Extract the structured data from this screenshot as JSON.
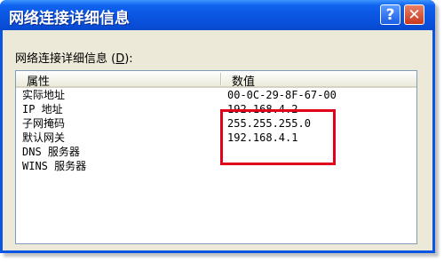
{
  "window": {
    "title": "网络连接详细信息",
    "help_label": "?",
    "close_label": "✕"
  },
  "caption": {
    "text": "网络连接详细信息 (",
    "accesskey": "D",
    "suffix": "):"
  },
  "table": {
    "columns": [
      "属性",
      "数值"
    ],
    "rows": [
      {
        "property": "实际地址",
        "value": "00-0C-29-8F-67-00"
      },
      {
        "property": "IP 地址",
        "value": "192.168.4.2"
      },
      {
        "property": "子网掩码",
        "value": "255.255.255.0"
      },
      {
        "property": "默认网关",
        "value": "192.168.4.1"
      },
      {
        "property": "DNS 服务器",
        "value": ""
      },
      {
        "property": "WINS 服务器",
        "value": ""
      }
    ]
  },
  "colors": {
    "titlebar": "#0a55e2",
    "highlight_box": "#e0001a",
    "client_bg": "#ece9d8"
  }
}
